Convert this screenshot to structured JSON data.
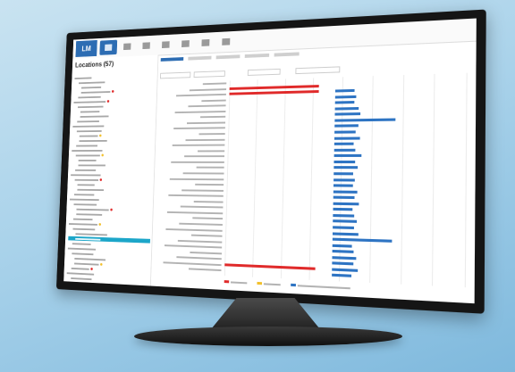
{
  "app": {
    "logo": "LM",
    "page_title": "Locations (57)"
  },
  "nav": [
    {
      "id": "hub",
      "active": true
    },
    {
      "id": "charts",
      "active": false
    },
    {
      "id": "documents",
      "active": false
    },
    {
      "id": "people",
      "active": false
    },
    {
      "id": "settings",
      "active": false
    },
    {
      "id": "tools",
      "active": false
    },
    {
      "id": "more",
      "active": false
    }
  ],
  "tree_items": 46,
  "selected_index": 33,
  "chart_data": {
    "type": "bar",
    "series": [
      {
        "name": "",
        "color": "#e02a2a",
        "values": [
          0,
          0.95,
          0.95,
          0,
          0,
          0,
          0,
          0,
          0,
          0,
          0,
          0,
          0,
          0,
          0,
          0,
          0,
          0,
          0,
          0,
          0,
          0,
          0,
          0,
          0,
          0,
          0,
          0,
          0,
          0,
          0,
          0,
          0.95,
          0
        ]
      },
      {
        "name": "",
        "color": "#2e74c3",
        "values": [
          0,
          0,
          0.09,
          0.1,
          0.09,
          0.11,
          0.12,
          0.28,
          0.11,
          0.1,
          0.12,
          0.09,
          0.1,
          0.13,
          0.1,
          0.11,
          0.09,
          0.1,
          0.09,
          0.11,
          0.1,
          0.12,
          0.09,
          0.1,
          0.11,
          0.1,
          0.12,
          0.27,
          0.09,
          0.1,
          0.11,
          0.1,
          0.12,
          0.09
        ]
      }
    ]
  },
  "colors": {
    "accent": "#2d6db3",
    "selected": "#1ca6c9",
    "red": "#e02a2a",
    "blue": "#2e74c3",
    "yellow": "#f2c02c"
  }
}
